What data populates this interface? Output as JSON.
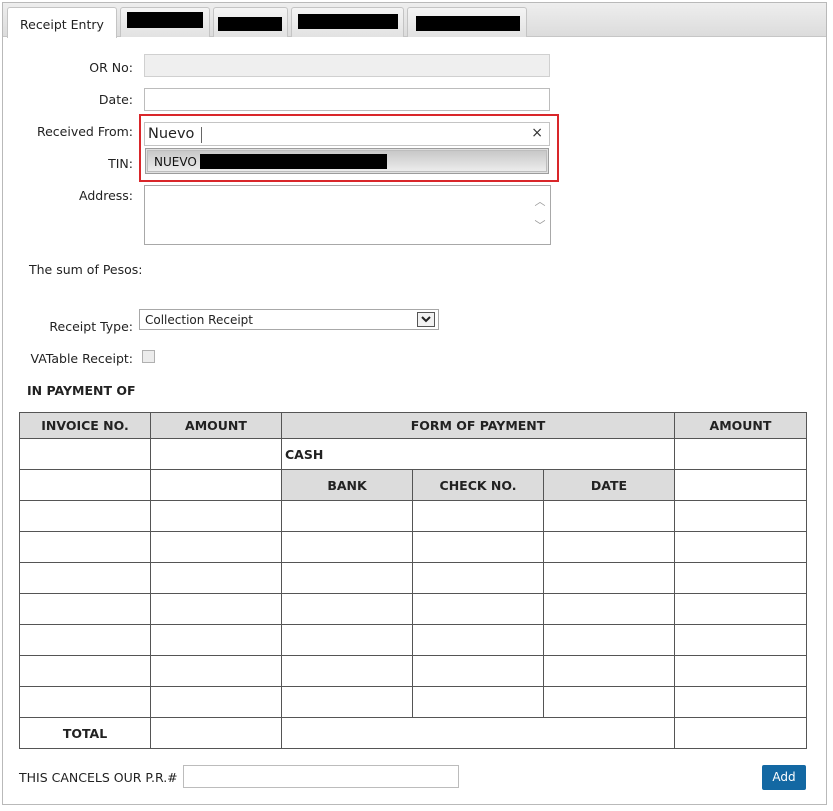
{
  "tabs": [
    {
      "label": "Receipt Entry",
      "active": true
    },
    {
      "label": "",
      "redacted": true
    },
    {
      "label": "",
      "redacted": true
    },
    {
      "label": "",
      "redacted": true
    },
    {
      "label": "",
      "redacted": true
    }
  ],
  "form": {
    "or_no_label": "OR No:",
    "or_no_value": "",
    "date_label": "Date:",
    "date_value": "",
    "received_from_label": "Received From:",
    "received_from_value": "Nuevo",
    "received_from_clear": "×",
    "received_from_suggestion": "NUEVO",
    "tin_label": "TIN:",
    "address_label": "Address:",
    "sum_label": "The sum of Pesos:",
    "receipt_type_label": "Receipt Type:",
    "receipt_type_value": "Collection Receipt",
    "vatable_label": "VATable Receipt:",
    "vatable_checked": false
  },
  "payment": {
    "title": "IN PAYMENT OF",
    "headers": {
      "invoice_no": "INVOICE NO.",
      "amount": "AMOUNT",
      "form_of_payment": "FORM OF PAYMENT",
      "amount_right": "AMOUNT"
    },
    "cash_label": "CASH",
    "sub_headers": {
      "bank": "BANK",
      "check_no": "CHECK NO.",
      "date": "DATE"
    },
    "total_label": "TOTAL"
  },
  "footer": {
    "cancels_label": "THIS CANCELS OUR P.R.#",
    "cancels_value": "",
    "add_button": "Add"
  },
  "colors": {
    "highlight": "#d9262a",
    "add_button": "#1368a3",
    "header_bg": "#dcdcdc"
  }
}
